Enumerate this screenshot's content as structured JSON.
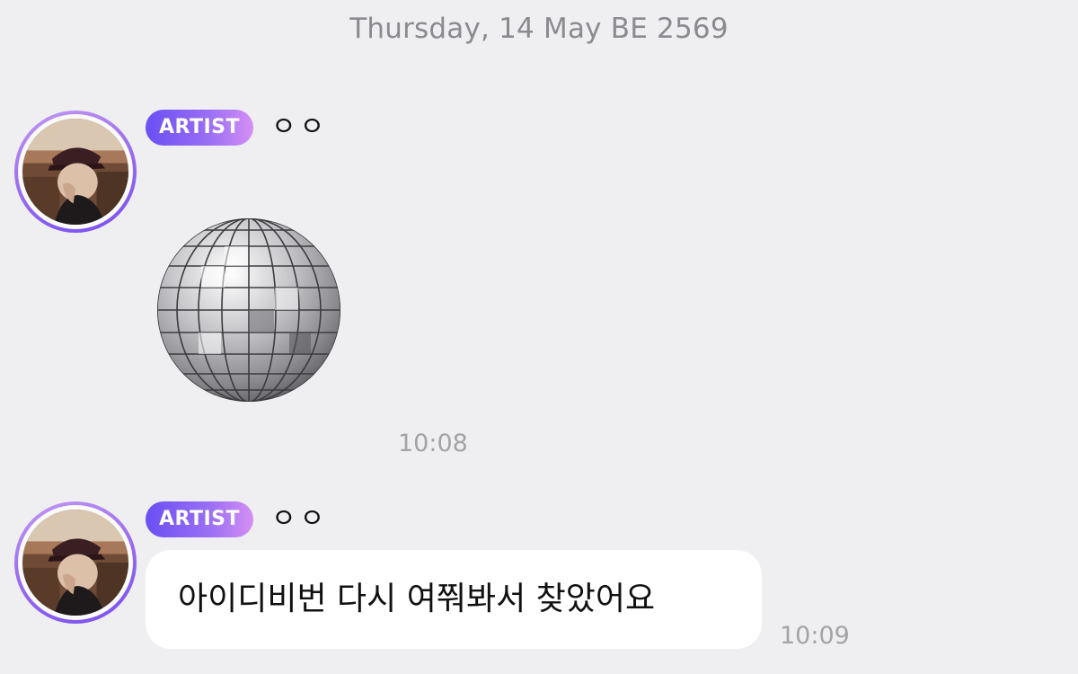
{
  "date_separator": "Thursday, 14 May BE 2569",
  "messages": [
    {
      "badge": "ARTIST",
      "sender": "ㅇㅇ",
      "sticker": "disco-ball",
      "time": "10:08"
    },
    {
      "badge": "ARTIST",
      "sender": "ㅇㅇ",
      "text": "아이디비번 다시 여쭤봐서 찾았어요",
      "time": "10:09"
    }
  ],
  "colors": {
    "background": "#efeff1",
    "badge_gradient_start": "#6a4ff4",
    "badge_gradient_end": "#d48ff4",
    "avatar_ring": "#9c6ff0",
    "timestamp": "#a3a3a8",
    "bubble": "#ffffff"
  }
}
